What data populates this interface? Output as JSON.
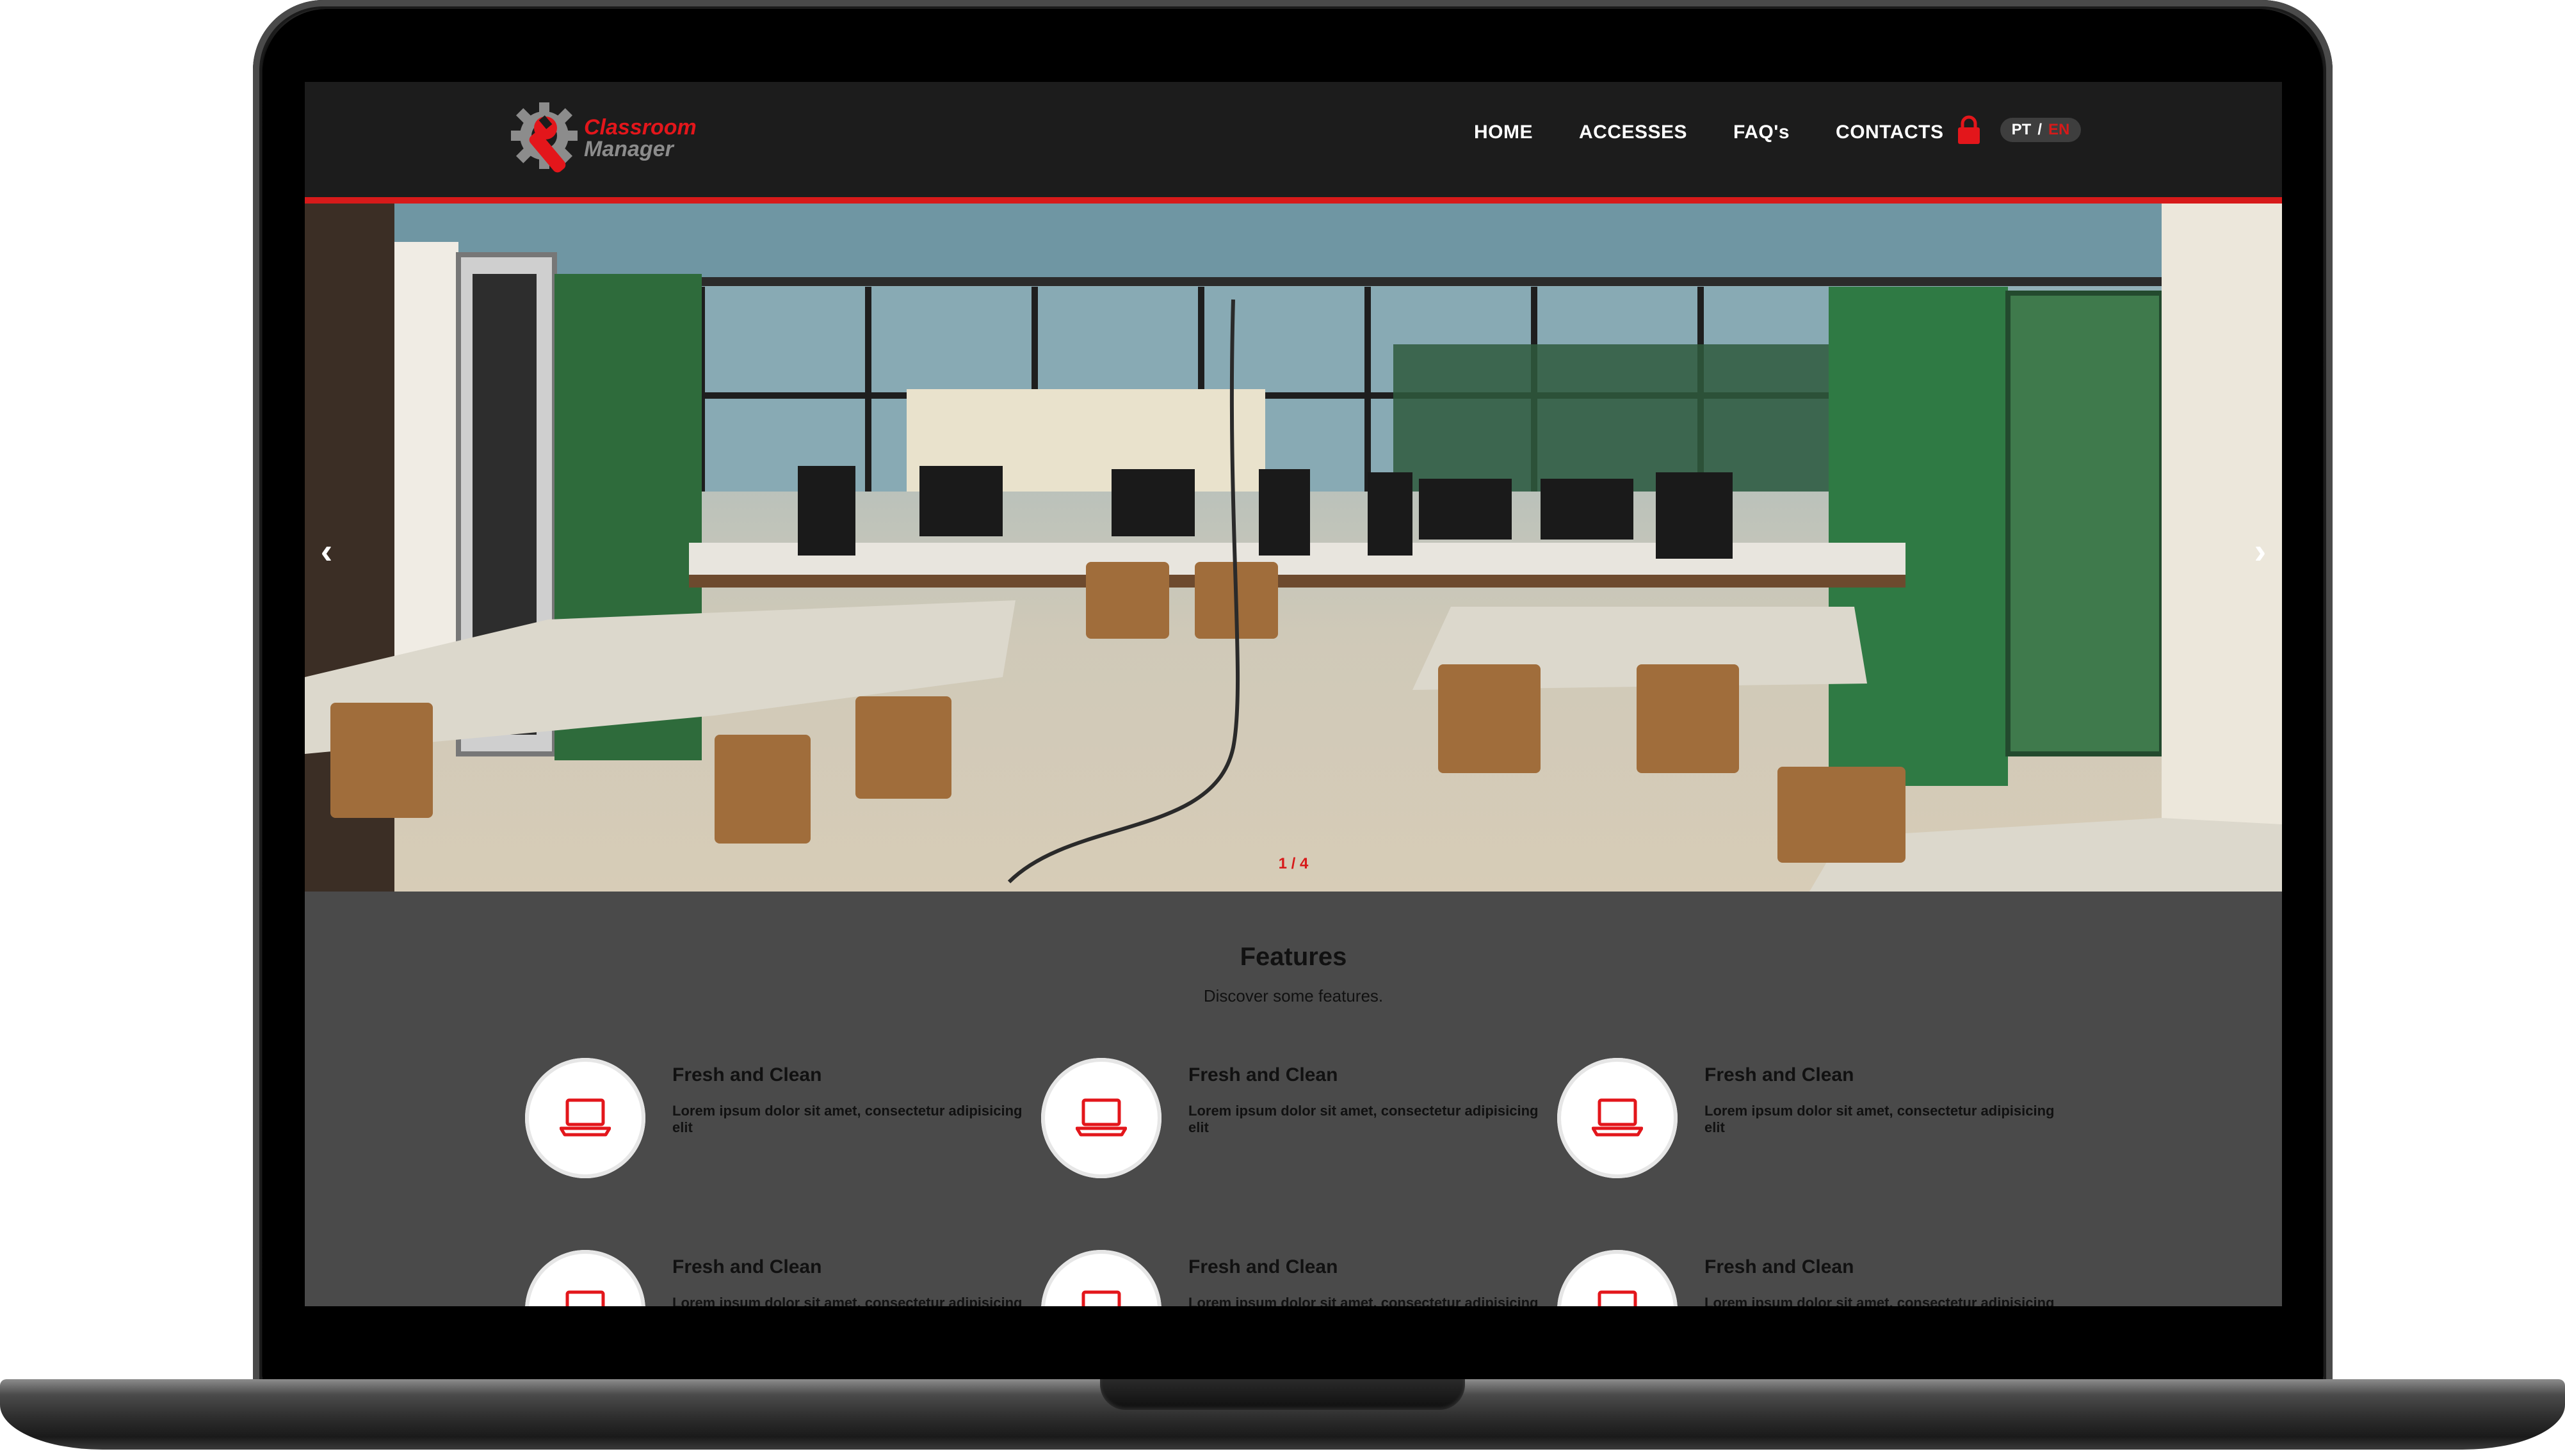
{
  "brand": {
    "line1": "Classroom",
    "line2": "Manager"
  },
  "nav": {
    "items": [
      "HOME",
      "ACCESSES",
      "FAQ's",
      "CONTACTS"
    ],
    "lang": {
      "pt": "PT",
      "sep": "/",
      "en": "EN"
    }
  },
  "slider": {
    "prev": "‹",
    "next": "›",
    "counter": "1 / 4"
  },
  "features": {
    "title": "Features",
    "subtitle": "Discover some features.",
    "items": [
      {
        "title": "Fresh and Clean",
        "desc": "Lorem ipsum dolor sit amet, consectetur adipisicing elit"
      },
      {
        "title": "Fresh and Clean",
        "desc": "Lorem ipsum dolor sit amet, consectetur adipisicing elit"
      },
      {
        "title": "Fresh and Clean",
        "desc": "Lorem ipsum dolor sit amet, consectetur adipisicing elit"
      },
      {
        "title": "Fresh and Clean",
        "desc": "Lorem ipsum dolor sit amet, consectetur adipisicing elit"
      },
      {
        "title": "Fresh and Clean",
        "desc": "Lorem ipsum dolor sit amet, consectetur adipisicing elit"
      },
      {
        "title": "Fresh and Clean",
        "desc": "Lorem ipsum dolor sit amet, consectetur adipisicing elit"
      }
    ],
    "icon": "laptop-icon"
  },
  "colors": {
    "accent": "#d71a1a",
    "navbar": "#1c1c1c",
    "section": "#4a4a4a"
  }
}
